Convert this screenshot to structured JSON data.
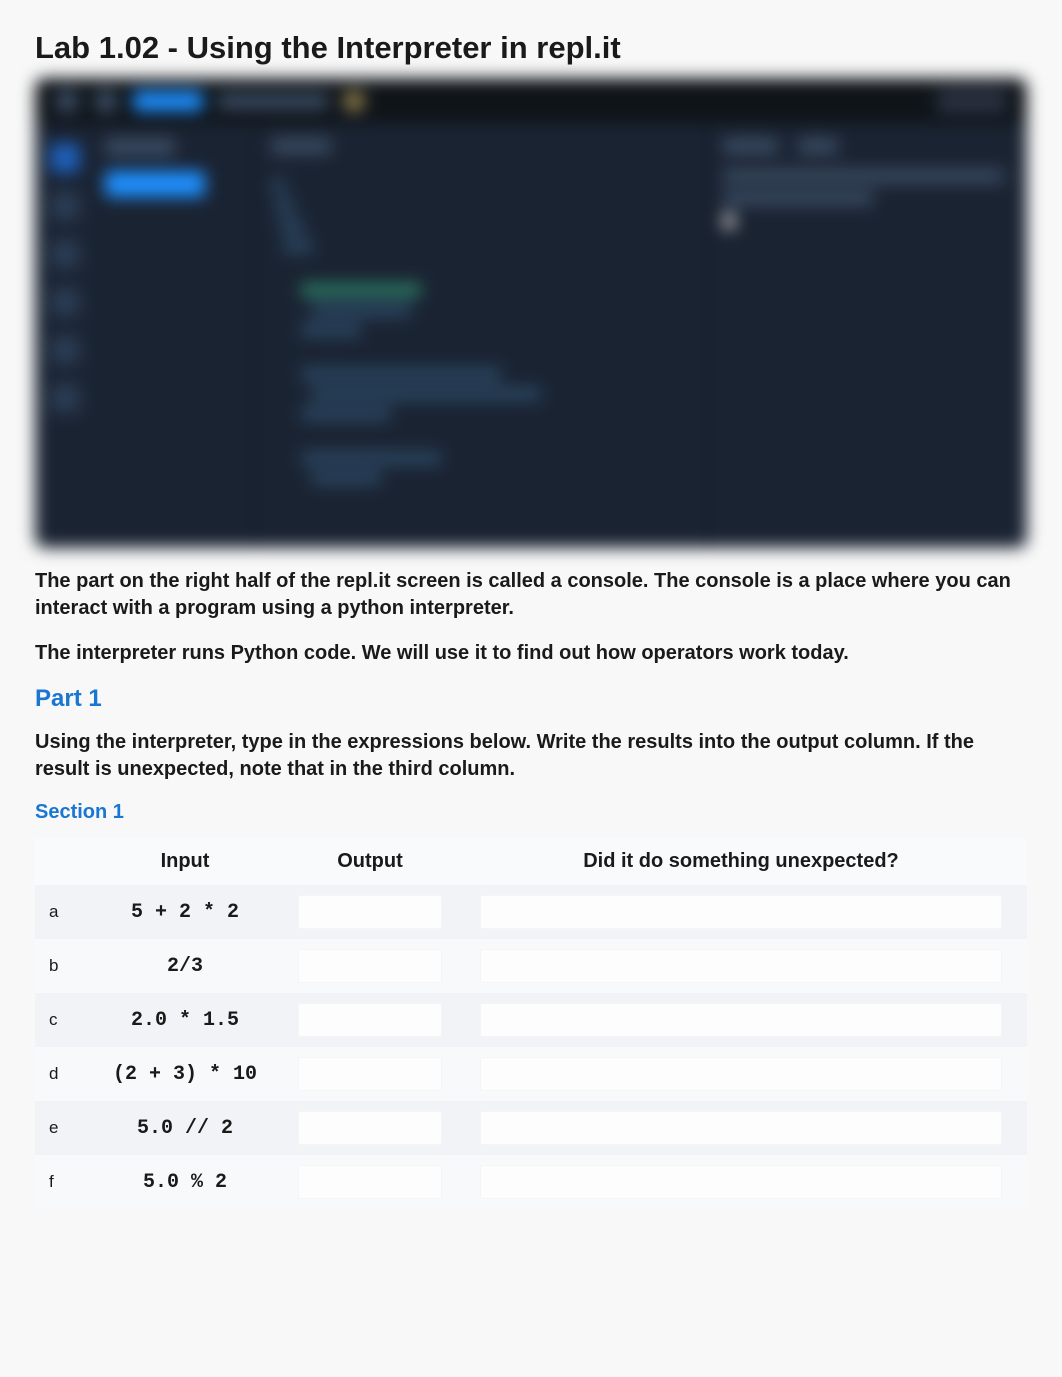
{
  "title": "Lab 1.02 - Using the Interpreter in repl.it",
  "paragraphs": {
    "p1": "The part on the right half of the repl.it screen is called a console. The console is a place where you can interact with a program using a python interpreter.",
    "p2": "The interpreter runs Python code. We will use it to find out how operators work today."
  },
  "part1": {
    "heading": "Part 1",
    "instructions": "Using the interpreter, type in the expressions below. Write the results into the output column. If the result is unexpected, note that in the third column.",
    "section1": {
      "heading": "Section 1",
      "columns": {
        "blank": "",
        "input": "Input",
        "output": "Output",
        "unexpected": "Did it do something unexpected?"
      },
      "rows": [
        {
          "label": "a",
          "input": "5 + 2 * 2",
          "output": "",
          "unexpected": ""
        },
        {
          "label": "b",
          "input": "2/3",
          "output": "",
          "unexpected": ""
        },
        {
          "label": "c",
          "input": "2.0 * 1.5",
          "output": "",
          "unexpected": ""
        },
        {
          "label": "d",
          "input": "(2 + 3) * 10",
          "output": "",
          "unexpected": ""
        },
        {
          "label": "e",
          "input": "5.0 // 2",
          "output": "",
          "unexpected": ""
        },
        {
          "label": "f",
          "input": "5.0 % 2",
          "output": "",
          "unexpected": ""
        }
      ]
    }
  }
}
